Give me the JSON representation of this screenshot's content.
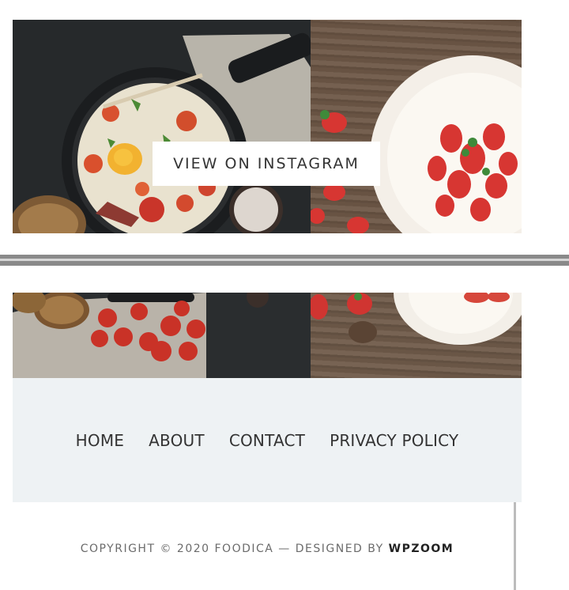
{
  "instagram": {
    "button_label": "VIEW ON INSTAGRAM",
    "images": [
      "pan-with-eggs-photo",
      "strawberry-pavlova-photo",
      "tomatoes-and-bread-photo",
      "wood-table-photo"
    ]
  },
  "footer": {
    "menu": [
      {
        "label": "HOME"
      },
      {
        "label": "ABOUT"
      },
      {
        "label": "CONTACT"
      },
      {
        "label": "PRIVACY POLICY"
      }
    ],
    "copyright_text": "COPYRIGHT © 2020 FOODICA — DESIGNED BY ",
    "designer_link": "WPZOOM"
  },
  "colors": {
    "footer_bg": "#eef2f4",
    "text_dark": "#333333",
    "text_muted": "#6b6b6b"
  }
}
